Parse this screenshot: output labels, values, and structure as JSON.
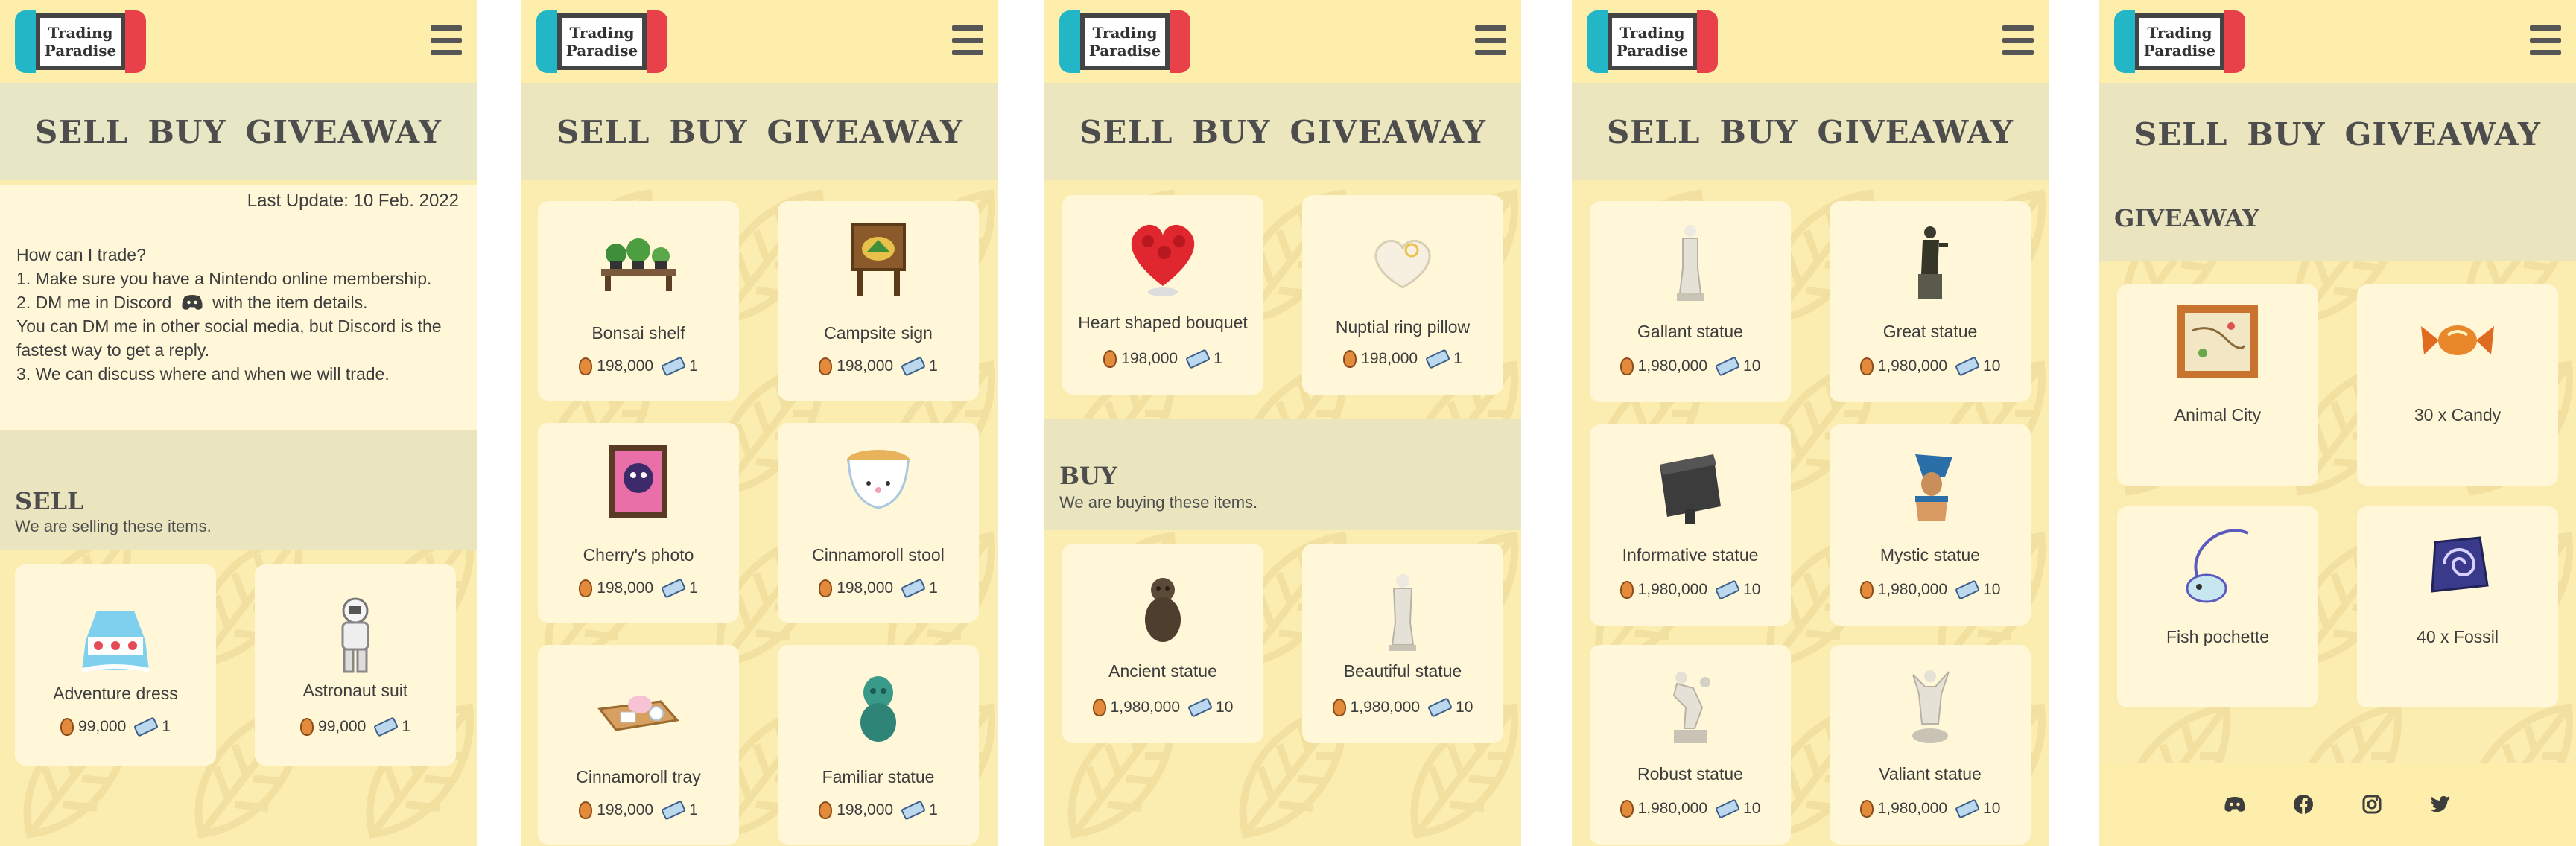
{
  "brand": {
    "line1": "Trading",
    "line2": "Paradise"
  },
  "nav": {
    "sell": "SELL",
    "buy": "BUY",
    "giveaway": "GIVEAWAY"
  },
  "info": {
    "last_update": "Last Update: 10 Feb. 2022",
    "q": "How can I trade?",
    "s1": "1. Make sure you have a Nintendo online membership.",
    "s2a": "2. DM me in Discord",
    "s2b": "with the item details.",
    "s3": "You can DM me in other social media, but Discord is the fastest way to get a reply.",
    "s4": "3. We can discuss where and when we will trade."
  },
  "sell": {
    "title": "SELL",
    "subtitle": "We are selling these items."
  },
  "buy": {
    "title": "BUY",
    "subtitle": "We are buying these items."
  },
  "giveaway": {
    "title": "GIVEAWAY"
  },
  "screen1": [
    {
      "name": "Adventure dress",
      "bells": "99,000",
      "tickets": "1"
    },
    {
      "name": "Astronaut suit",
      "bells": "99,000",
      "tickets": "1"
    }
  ],
  "screen2": [
    {
      "name": "Bonsai shelf",
      "bells": "198,000",
      "tickets": "1"
    },
    {
      "name": "Campsite sign",
      "bells": "198,000",
      "tickets": "1"
    },
    {
      "name": "Cherry's photo",
      "bells": "198,000",
      "tickets": "1"
    },
    {
      "name": "Cinnamoroll stool",
      "bells": "198,000",
      "tickets": "1"
    },
    {
      "name": "Cinnamoroll tray",
      "bells": "198,000",
      "tickets": "1"
    },
    {
      "name": "Familiar statue",
      "bells": "198,000",
      "tickets": "1"
    }
  ],
  "screen3_sell": [
    {
      "name": "Heart shaped bouquet",
      "bells": "198,000",
      "tickets": "1"
    },
    {
      "name": "Nuptial ring pillow",
      "bells": "198,000",
      "tickets": "1"
    }
  ],
  "screen3_buy": [
    {
      "name": "Ancient statue",
      "bells": "1,980,000",
      "tickets": "10"
    },
    {
      "name": "Beautiful statue",
      "bells": "1,980,000",
      "tickets": "10"
    }
  ],
  "screen4": [
    {
      "name": "Gallant statue",
      "bells": "1,980,000",
      "tickets": "10"
    },
    {
      "name": "Great statue",
      "bells": "1,980,000",
      "tickets": "10"
    },
    {
      "name": "Informative statue",
      "bells": "1,980,000",
      "tickets": "10"
    },
    {
      "name": "Mystic statue",
      "bells": "1,980,000",
      "tickets": "10"
    },
    {
      "name": "Robust statue",
      "bells": "1,980,000",
      "tickets": "10"
    },
    {
      "name": "Valiant statue",
      "bells": "1,980,000",
      "tickets": "10"
    }
  ],
  "screen5": [
    {
      "name": "Animal City"
    },
    {
      "name": "30 x Candy"
    },
    {
      "name": "Fish pochette"
    },
    {
      "name": "40 x Fossil"
    }
  ],
  "footer_icons": [
    "discord-icon",
    "facebook-icon",
    "instagram-icon",
    "twitter-icon"
  ]
}
